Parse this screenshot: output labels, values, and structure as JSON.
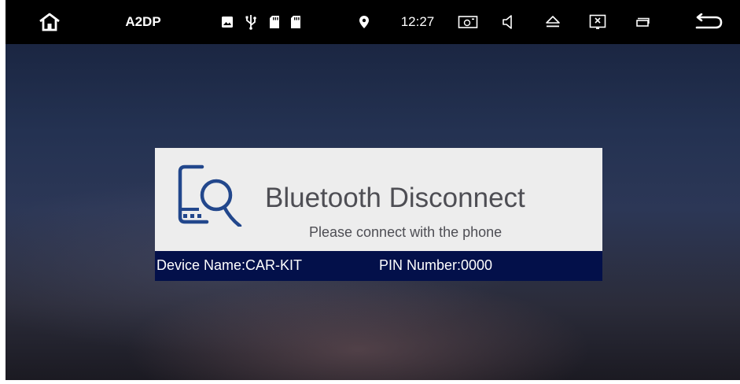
{
  "statusbar": {
    "profile_label": "A2DP",
    "time": "12:27",
    "icons": [
      "home-icon",
      "image-icon",
      "usb-icon",
      "sd-card-icon",
      "sd-card-icon",
      "location-icon",
      "screen-icon",
      "volume-icon",
      "eject-icon",
      "close-window-icon",
      "recent-apps-icon",
      "back-icon"
    ]
  },
  "dialog": {
    "title": "Bluetooth Disconnect",
    "subtitle": "Please connect with the phone",
    "device_name": "Device Name:CAR-KIT",
    "pin_number": "PIN Number:0000"
  },
  "colors": {
    "statusbar_bg": "#000000",
    "dialog_bg": "#ededed",
    "info_bar_bg": "#03104a",
    "icon_blue": "#22478c",
    "text_gray": "#4e4e54"
  }
}
